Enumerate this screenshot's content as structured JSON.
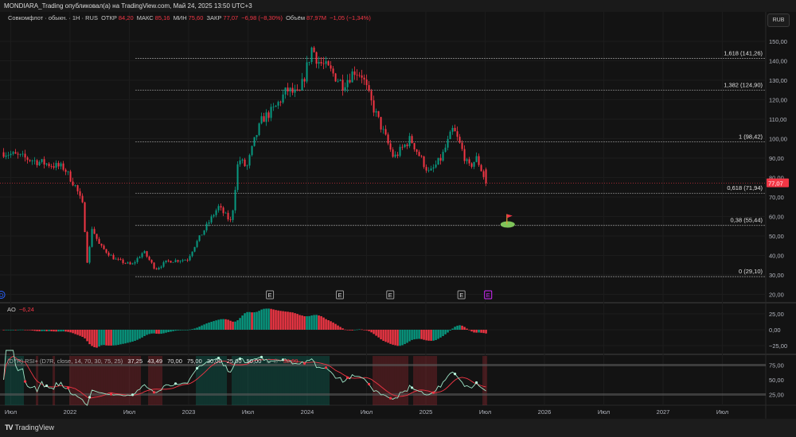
{
  "header": {
    "publisher_line": "MONDIARA_Trading опубликовал(а) на TradingView.com, Май 24, 2025 13:50 UTC+3"
  },
  "legend": {
    "symbol": "Совкомфлот · обыкн. · 1H · RUS",
    "open_label": "ОТКР",
    "open": "84,20",
    "high_label": "МАКС",
    "high": "85,16",
    "low_label": "МИН",
    "low": "75,60",
    "close_label": "ЗАКР",
    "close": "77,07",
    "change": "−6,98 (−8,30%)",
    "volume_label": "Объём",
    "volume": "87,97M",
    "volume_change": "−1,05 (−1,34%)"
  },
  "currency": "RUB",
  "last_price_label": "77,07",
  "colors": {
    "up": "#089981",
    "down": "#f23645",
    "bg": "#131313",
    "fib": "#8a8a8a",
    "event": "#9c27b0"
  },
  "chart_data": {
    "type": "candlestick",
    "title": "Совкомфлот · обыкн. · 1H · RUS",
    "ylim": [
      20,
      155
    ],
    "xlim": [
      2021.41,
      2027.83
    ],
    "price_path": [
      [
        2021.44,
        93
      ],
      [
        2021.74,
        88
      ],
      [
        2021.95,
        85
      ],
      [
        2022.05,
        75
      ],
      [
        2022.11,
        65
      ],
      [
        2022.15,
        33
      ],
      [
        2022.18,
        55
      ],
      [
        2022.25,
        45
      ],
      [
        2022.38,
        38
      ],
      [
        2022.52,
        35
      ],
      [
        2022.62,
        42
      ],
      [
        2022.72,
        33
      ],
      [
        2022.82,
        37
      ],
      [
        2022.99,
        38
      ],
      [
        2023.05,
        45
      ],
      [
        2023.15,
        55
      ],
      [
        2023.25,
        65
      ],
      [
        2023.36,
        57
      ],
      [
        2023.42,
        90
      ],
      [
        2023.49,
        85
      ],
      [
        2023.56,
        100
      ],
      [
        2023.62,
        110
      ],
      [
        2023.72,
        115
      ],
      [
        2023.83,
        125
      ],
      [
        2023.93,
        122
      ],
      [
        2023.99,
        135
      ],
      [
        2024.04,
        147
      ],
      [
        2024.09,
        140
      ],
      [
        2024.19,
        135
      ],
      [
        2024.3,
        128
      ],
      [
        2024.4,
        135
      ],
      [
        2024.46,
        133
      ],
      [
        2024.53,
        120
      ],
      [
        2024.63,
        105
      ],
      [
        2024.73,
        90
      ],
      [
        2024.8,
        95
      ],
      [
        2024.87,
        100
      ],
      [
        2024.93,
        93
      ],
      [
        2025.03,
        82
      ],
      [
        2025.13,
        90
      ],
      [
        2025.23,
        105
      ],
      [
        2025.3,
        95
      ],
      [
        2025.36,
        85
      ],
      [
        2025.43,
        90
      ],
      [
        2025.51,
        77.07
      ]
    ],
    "last_candle": {
      "open": 84.2,
      "high": 85.16,
      "low": 75.6,
      "close": 77.07
    },
    "price_axis": [
      {
        "v": 150,
        "label": "150,00"
      },
      {
        "v": 140,
        "label": "140,00"
      },
      {
        "v": 130,
        "label": "130,00"
      },
      {
        "v": 120,
        "label": "120,00"
      },
      {
        "v": 110,
        "label": "110,00"
      },
      {
        "v": 100,
        "label": "100,00"
      },
      {
        "v": 90,
        "label": "90,00"
      },
      {
        "v": 80,
        "label": "80,00"
      },
      {
        "v": 70,
        "label": "70,00"
      },
      {
        "v": 60,
        "label": "60,00"
      },
      {
        "v": 50,
        "label": "50,00"
      },
      {
        "v": 40,
        "label": "40,00"
      },
      {
        "v": 30,
        "label": "30,00"
      },
      {
        "v": 20,
        "label": "20,00"
      }
    ],
    "fib_levels": [
      {
        "v": 141.26,
        "label": "1,618 (141,26)"
      },
      {
        "v": 124.9,
        "label": "1,382 (124,90)"
      },
      {
        "v": 98.42,
        "label": "1 (98,42)"
      },
      {
        "v": 71.94,
        "label": "0,618 (71,94)"
      },
      {
        "v": 55.44,
        "label": "0,38 (55,44)"
      },
      {
        "v": 29.1,
        "label": "0 (29,10)"
      }
    ],
    "fib_start": 2022.55,
    "time_axis": [
      {
        "t": 2021.5,
        "label": "Июл"
      },
      {
        "t": 2022.0,
        "label": "2022"
      },
      {
        "t": 2022.5,
        "label": "Июл"
      },
      {
        "t": 2023.0,
        "label": "2023"
      },
      {
        "t": 2023.5,
        "label": "Июл"
      },
      {
        "t": 2024.0,
        "label": "2024"
      },
      {
        "t": 2024.5,
        "label": "Июл"
      },
      {
        "t": 2025.0,
        "label": "2025"
      },
      {
        "t": 2025.5,
        "label": "Июл"
      },
      {
        "t": 2026.0,
        "label": "2026"
      },
      {
        "t": 2026.5,
        "label": "Июл"
      },
      {
        "t": 2027.0,
        "label": "2027"
      },
      {
        "t": 2027.5,
        "label": "Июл"
      }
    ],
    "events": [
      {
        "t": 2021.42,
        "label": "D",
        "kind": "dividend"
      },
      {
        "t": 2023.685,
        "label": "E",
        "kind": "earnings"
      },
      {
        "t": 2024.275,
        "label": "E",
        "kind": "earnings"
      },
      {
        "t": 2024.7,
        "label": "E",
        "kind": "earnings"
      },
      {
        "t": 2025.3,
        "label": "E",
        "kind": "earnings"
      },
      {
        "t": 2025.525,
        "label": "E",
        "kind": "earnings-upcoming"
      }
    ],
    "flag": {
      "t": 2025.69,
      "v": 60
    }
  },
  "ao": {
    "name": "AO",
    "value": "−6,24",
    "axis": [
      {
        "v": 25,
        "label": "25,00"
      },
      {
        "v": 0,
        "label": "0,00"
      },
      {
        "v": -25,
        "label": "−25,00"
      }
    ]
  },
  "rsi": {
    "title": "(D7R) RSI+ (D7R, close, 14, 70, 30, 75, 25)",
    "values": [
      "37,25",
      "43,49",
      "70,00",
      "75,00",
      "30,00",
      "25,00",
      "50,00"
    ],
    "glyphs": "∅ ∅",
    "last": "38,09",
    "axis": [
      {
        "v": 75,
        "label": "75,00"
      },
      {
        "v": 50,
        "label": "50,00"
      },
      {
        "v": 25,
        "label": "25,00"
      }
    ]
  },
  "footer": {
    "brand": "TradingView"
  }
}
